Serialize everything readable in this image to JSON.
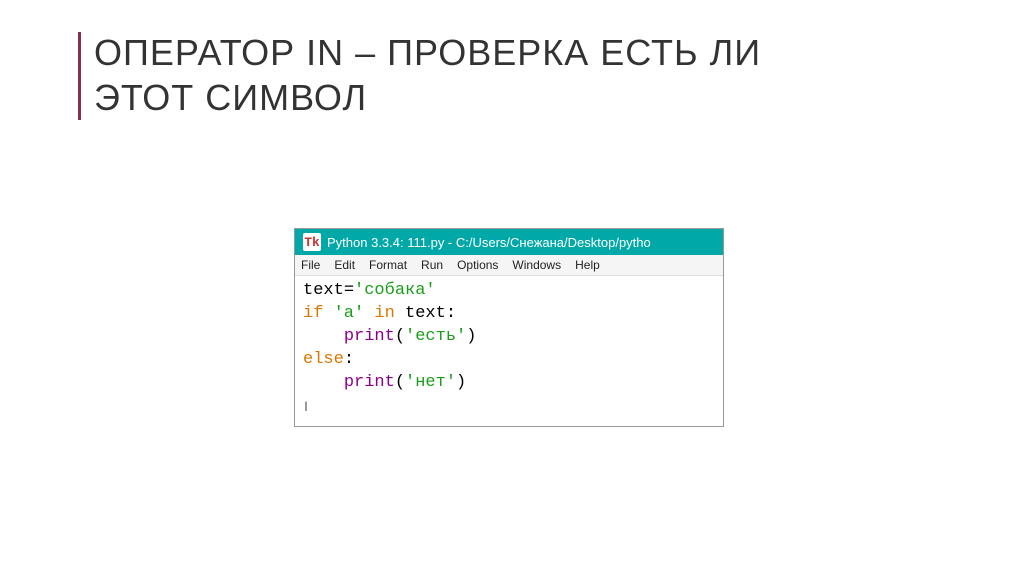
{
  "slide": {
    "title_line1": "ОПЕРАТОР IN – ПРОВЕРКА ЕСТЬ ЛИ",
    "title_line2": "ЭТОТ СИМВОЛ"
  },
  "editor": {
    "app_icon_label": "Tk",
    "window_title": "Python 3.3.4: 111.py - C:/Users/Снежана/Desktop/pytho",
    "menu": {
      "file": "File",
      "edit": "Edit",
      "format": "Format",
      "run": "Run",
      "options": "Options",
      "windows": "Windows",
      "help": "Help"
    },
    "code": {
      "line1_var": "text",
      "line1_eq": "=",
      "line1_str": "'собака'",
      "line2_if": "if",
      "line2_str": "'а'",
      "line2_in": "in",
      "line2_var": "text",
      "line2_colon": ":",
      "line3_indent": "    ",
      "line3_fn": "print",
      "line3_open": "(",
      "line3_str": "'есть'",
      "line3_close": ")",
      "line4_else": "else",
      "line4_colon": ":",
      "line5_indent": "    ",
      "line5_fn": "print",
      "line5_open": "(",
      "line5_str": "'нет'",
      "line5_close": ")"
    }
  }
}
